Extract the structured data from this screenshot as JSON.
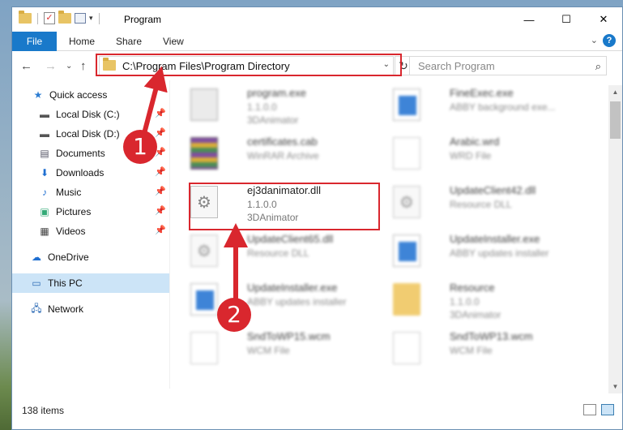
{
  "window": {
    "title": "Program"
  },
  "ribbon": {
    "file": "File",
    "tabs": [
      "Home",
      "Share",
      "View"
    ],
    "help": "?"
  },
  "nav": {
    "back": "←",
    "forward": "→",
    "recent": "⌄",
    "up": "↑"
  },
  "address": {
    "path": "C:\\Program Files\\Program Directory",
    "refresh": "↻"
  },
  "search": {
    "placeholder": "Search Program",
    "icon": "⌕"
  },
  "sidebar": {
    "items": [
      {
        "label": "Quick access",
        "icon": "star-icon",
        "pinned": false
      },
      {
        "label": "Local Disk (C:)",
        "icon": "drive-icon",
        "pinned": true
      },
      {
        "label": "Local Disk (D:)",
        "icon": "drive-icon",
        "pinned": true
      },
      {
        "label": "Documents",
        "icon": "documents-icon",
        "pinned": true
      },
      {
        "label": "Downloads",
        "icon": "downloads-icon",
        "pinned": true
      },
      {
        "label": "Music",
        "icon": "music-icon",
        "pinned": true
      },
      {
        "label": "Pictures",
        "icon": "pictures-icon",
        "pinned": true
      },
      {
        "label": "Videos",
        "icon": "videos-icon",
        "pinned": true
      },
      {
        "label": "OneDrive",
        "icon": "onedrive-icon",
        "pinned": false
      },
      {
        "label": "This PC",
        "icon": "computer-icon",
        "pinned": false,
        "selected": true
      },
      {
        "label": "Network",
        "icon": "network-icon",
        "pinned": false
      }
    ]
  },
  "files": [
    {
      "name": "program.exe",
      "line2": "1.1.0.0",
      "line3": "3DAnimator",
      "icon": "exe-icon"
    },
    {
      "name": "FineExec.exe",
      "line2": "ABBY background exe...",
      "line3": "",
      "icon": "app-window-icon"
    },
    {
      "name": "certificates.cab",
      "line2": "WinRAR Archive",
      "line3": "",
      "icon": "rar-icon"
    },
    {
      "name": "Arabic.wrd",
      "line2": "WRD File",
      "line3": "",
      "icon": "file-icon"
    },
    {
      "name": "ej3danimator.dll",
      "line2": "1.1.0.0",
      "line3": "3DAnimator",
      "icon": "dll-gear-icon",
      "highlight": true
    },
    {
      "name": "UpdateClient42.dll",
      "line2": "Resource DLL",
      "line3": "",
      "icon": "dll-gear-icon"
    },
    {
      "name": "UpdateClient65.dll",
      "line2": "Resource DLL",
      "line3": "",
      "icon": "dll-gear-icon"
    },
    {
      "name": "UpdateInstaller.exe",
      "line2": "ABBY updates installer",
      "line3": "",
      "icon": "app-window-icon"
    },
    {
      "name": "UpdateInstaller.exe",
      "line2": "ABBY updates installer",
      "line3": "",
      "icon": "app-window-icon"
    },
    {
      "name": "Resource",
      "line2": "1.1.0.0",
      "line3": "3DAnimator",
      "icon": "folder-icon"
    },
    {
      "name": "SndToWP15.wcm",
      "line2": "WCM File",
      "line3": "",
      "icon": "file-icon"
    },
    {
      "name": "SndToWP13.wcm",
      "line2": "WCM File",
      "line3": "",
      "icon": "file-icon"
    }
  ],
  "status": {
    "count": "138 items"
  },
  "callouts": [
    "1",
    "2"
  ],
  "colors": {
    "accent": "#1979ca",
    "highlight": "#d9272e",
    "selected": "#cce4f7"
  }
}
